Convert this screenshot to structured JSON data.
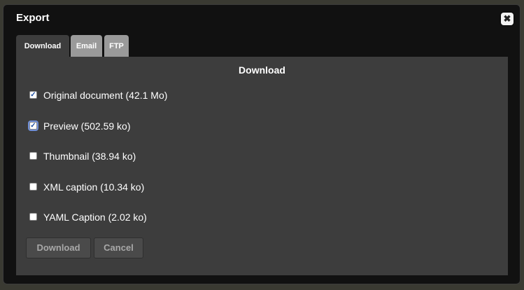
{
  "dialog": {
    "title": "Export",
    "close_icon": "close-icon"
  },
  "tabs": [
    {
      "label": "Download",
      "active": true
    },
    {
      "label": "Email",
      "active": false
    },
    {
      "label": "FTP",
      "active": false
    }
  ],
  "panel": {
    "title": "Download",
    "options": [
      {
        "label": "Original document (42.1 Mo)",
        "checked": true
      },
      {
        "label": "Preview (502.59 ko)",
        "checked": true
      },
      {
        "label": "Thumbnail (38.94 ko)",
        "checked": false
      },
      {
        "label": "XML caption (10.34 ko)",
        "checked": false
      },
      {
        "label": "YAML Caption (2.02 ko)",
        "checked": false
      }
    ],
    "download_label": "Download",
    "cancel_label": "Cancel"
  },
  "colors": {
    "panel_bg": "#3d3d3d",
    "tab_inactive": "#9a9a9a",
    "dialog_bg": "#111111"
  }
}
